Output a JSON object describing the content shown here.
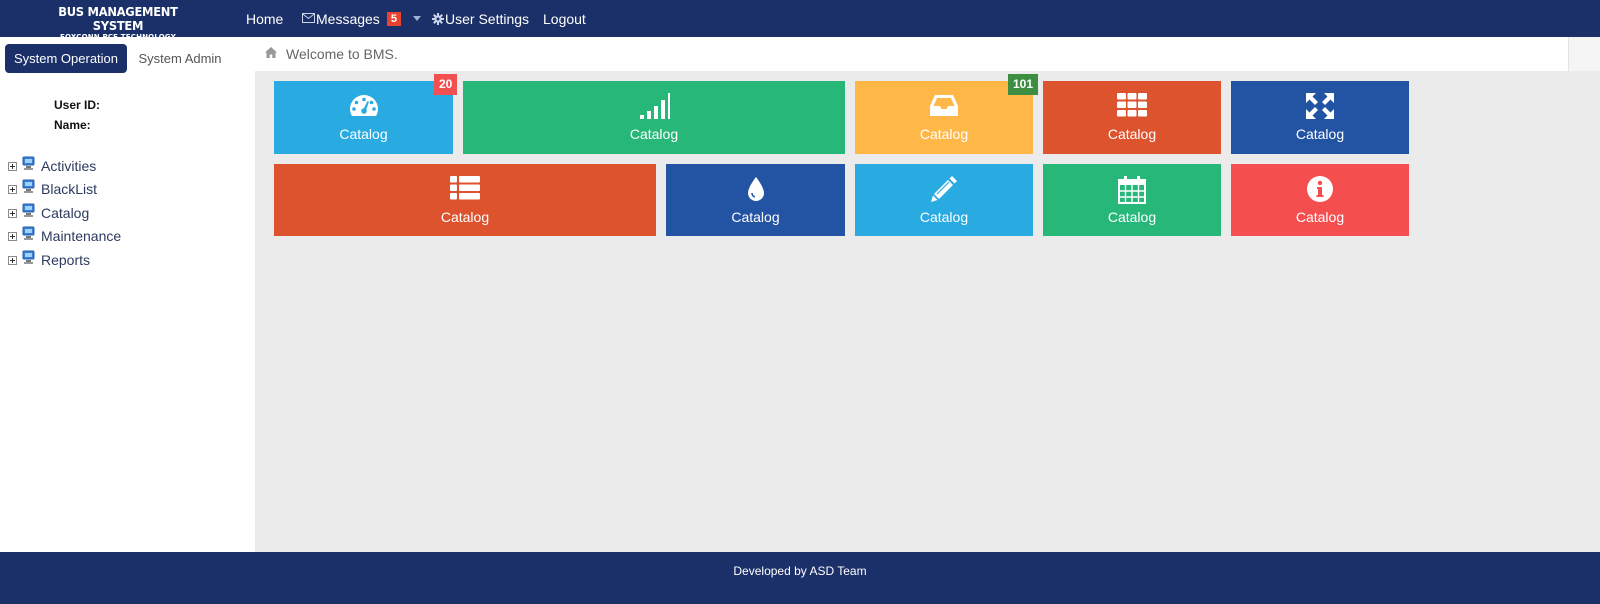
{
  "app": {
    "title": "BUS MANAGEMENT SYSTEM",
    "subtitle": "FOXCONN PCE TECHNOLOGY"
  },
  "nav": {
    "home": "Home",
    "messages": "Messages",
    "messages_count": "5",
    "user_settings": "User Settings",
    "logout": "Logout"
  },
  "sidebar": {
    "tabs": [
      {
        "label": "System Operation",
        "active": true
      },
      {
        "label": "System Admin",
        "active": false
      }
    ],
    "user_id_label": "User ID:",
    "name_label": "Name:",
    "tree": [
      {
        "label": "Activities",
        "icon": "monitor-icon"
      },
      {
        "label": "BlackList",
        "icon": "monitor-icon"
      },
      {
        "label": "Catalog",
        "icon": "monitor-icon"
      },
      {
        "label": "Maintenance",
        "icon": "monitor-icon"
      },
      {
        "label": "Reports",
        "icon": "monitor-icon"
      }
    ]
  },
  "breadcrumb": {
    "icon": "home-icon",
    "text": "Welcome to BMS."
  },
  "tiles": [
    {
      "label": "Catalog",
      "icon": "dashboard-icon",
      "color": "#29abe2",
      "badge": "20",
      "badge_color": "#f05050"
    },
    {
      "label": "Catalog",
      "icon": "signal-icon",
      "color": "#27b779"
    },
    {
      "label": "Catalog",
      "icon": "inbox-icon",
      "color": "#ffb848",
      "badge": "101",
      "badge_color": "#3e8e41"
    },
    {
      "label": "Catalog",
      "icon": "grid-icon",
      "color": "#dc532e"
    },
    {
      "label": "Catalog",
      "icon": "fullscreen-icon",
      "color": "#2354a3"
    },
    {
      "label": "Catalog",
      "icon": "list-icon",
      "color": "#dc532e"
    },
    {
      "label": "Catalog",
      "icon": "drop-icon",
      "color": "#2354a3"
    },
    {
      "label": "Catalog",
      "icon": "pencil-icon",
      "color": "#29abe2"
    },
    {
      "label": "Catalog",
      "icon": "calendar-icon",
      "color": "#27b779"
    },
    {
      "label": "Catalog",
      "icon": "info-icon",
      "color": "#f54e4e"
    }
  ],
  "footer": {
    "text": "Developed by ASD Team"
  },
  "colors": {
    "navbar": "#1b3068",
    "content_background": "#ebebeb"
  }
}
